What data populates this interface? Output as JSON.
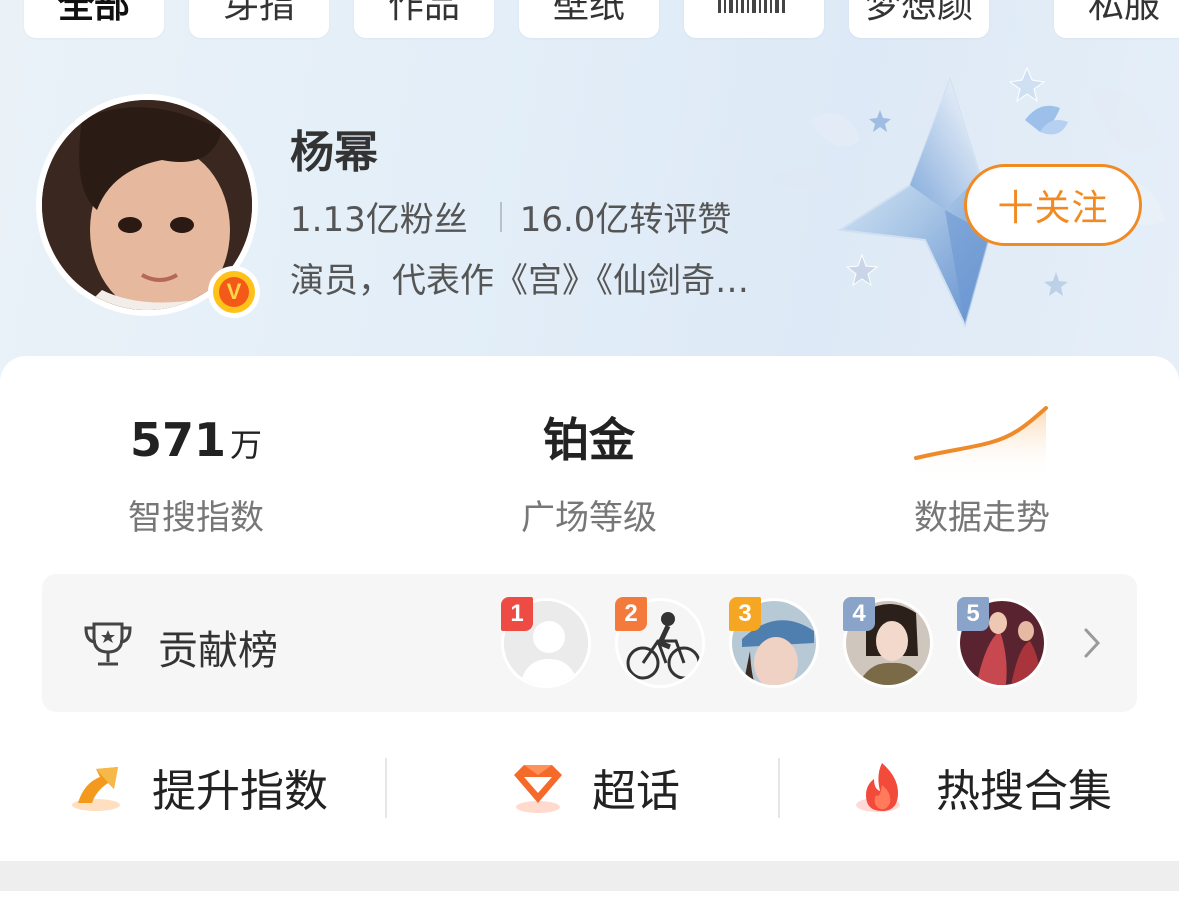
{
  "tabs": [
    {
      "label": "全部",
      "active": true
    },
    {
      "label": "芽指",
      "active": false
    },
    {
      "label": "作品",
      "active": false
    },
    {
      "label": "壁纸",
      "active": false
    },
    {
      "label": "",
      "active": false
    },
    {
      "label": "梦想颜",
      "active": false
    },
    {
      "label": "私服",
      "active": false
    }
  ],
  "profile": {
    "name": "杨幂",
    "followers": "1.13亿粉丝",
    "engagement": "16.0亿转评赞",
    "bio": "演员，代表作《宫》《仙剑奇…",
    "verified_badge": "V",
    "follow_label": "十关注"
  },
  "metrics": [
    {
      "value": "571",
      "unit": "万",
      "label": "智搜指数"
    },
    {
      "value": "铂金",
      "unit": "",
      "label": "广场等级"
    },
    {
      "value": "",
      "unit": "",
      "label": "数据走势"
    }
  ],
  "contribution": {
    "label": "贡献榜",
    "ranks": [
      "1",
      "2",
      "3",
      "4",
      "5"
    ]
  },
  "actions": [
    {
      "label": "提升指数",
      "icon": "arrow-up-icon"
    },
    {
      "label": "超话",
      "icon": "diamond-icon"
    },
    {
      "label": "热搜合集",
      "icon": "flame-icon"
    }
  ],
  "colors": {
    "accent_orange": "#f28a23",
    "rank1": "#ee4b45",
    "rank2": "#f47a3c",
    "rank3": "#f5a623",
    "rank4": "#8aa3c8",
    "rank5": "#8aa3c8"
  }
}
